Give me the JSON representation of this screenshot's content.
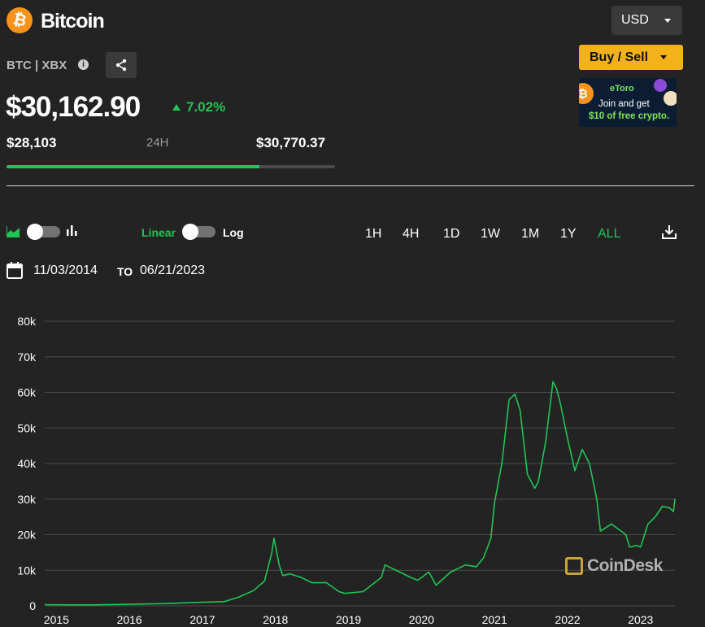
{
  "header": {
    "coin_name": "Bitcoin",
    "coin_symbol": "₿",
    "ticker": "BTC | XBX",
    "info_glyph": "i",
    "currency": "USD",
    "buy_sell": "Buy / Sell"
  },
  "ad": {
    "brand": "eToro",
    "line1": "Join and get",
    "line2": "$10 of free crypto.",
    "btc_symbol": "₿"
  },
  "price": {
    "current": "$30,162.90",
    "change": "7.02%",
    "low": "$28,103",
    "range_label": "24H",
    "high": "$30,770.37",
    "range_position": 0.77
  },
  "controls": {
    "linear": "Linear",
    "log": "Log",
    "ranges": [
      "1H",
      "4H",
      "1D",
      "1W",
      "1M",
      "1Y",
      "ALL"
    ],
    "active_range": "ALL",
    "date_from": "11/03/2014",
    "to_label": "TO",
    "date_to": "06/21/2023"
  },
  "watermark": "CoinDesk",
  "colors": {
    "accent": "#20c553",
    "brand": "#f7931a",
    "buy": "#f3b21b",
    "background": "#232323"
  },
  "chart_data": {
    "type": "line",
    "x_unit": "year",
    "y_ticks": [
      "0",
      "10k",
      "20k",
      "30k",
      "40k",
      "50k",
      "60k",
      "70k",
      "80k"
    ],
    "x_ticks": [
      "2015",
      "2016",
      "2017",
      "2018",
      "2019",
      "2020",
      "2021",
      "2022",
      "2023"
    ],
    "ylim": [
      0,
      80000
    ],
    "xlim": [
      2014.84,
      2023.47
    ],
    "grid": true,
    "series": [
      {
        "x": [
          2014.84,
          2015.0,
          2015.5,
          2016.0,
          2016.5,
          2017.0,
          2017.3,
          2017.5,
          2017.7,
          2017.85,
          2017.95,
          2017.98,
          2018.05,
          2018.1,
          2018.2,
          2018.35,
          2018.5,
          2018.7,
          2018.87,
          2018.95,
          2019.2,
          2019.45,
          2019.5,
          2019.7,
          2019.85,
          2019.95,
          2020.1,
          2020.2,
          2020.4,
          2020.6,
          2020.75,
          2020.85,
          2020.95,
          2021.0,
          2021.1,
          2021.2,
          2021.28,
          2021.35,
          2021.45,
          2021.55,
          2021.6,
          2021.7,
          2021.8,
          2021.85,
          2021.9,
          2022.0,
          2022.1,
          2022.2,
          2022.3,
          2022.4,
          2022.45,
          2022.6,
          2022.8,
          2022.85,
          2022.95,
          2023.0,
          2023.1,
          2023.2,
          2023.3,
          2023.4,
          2023.45,
          2023.47
        ],
        "y": [
          350,
          300,
          280,
          430,
          650,
          1000,
          1200,
          2500,
          4300,
          7000,
          15000,
          19000,
          11500,
          8500,
          9000,
          8000,
          6500,
          6500,
          4000,
          3500,
          4000,
          8000,
          11500,
          9500,
          8000,
          7200,
          9500,
          5800,
          9500,
          11500,
          11000,
          13500,
          19000,
          29000,
          40000,
          58000,
          59500,
          55000,
          37000,
          33000,
          35000,
          46000,
          63000,
          61000,
          57000,
          47000,
          38000,
          44000,
          40000,
          30000,
          21000,
          23000,
          20000,
          16500,
          17000,
          16500,
          23000,
          25000,
          28000,
          27500,
          26500,
          30100
        ]
      }
    ]
  }
}
